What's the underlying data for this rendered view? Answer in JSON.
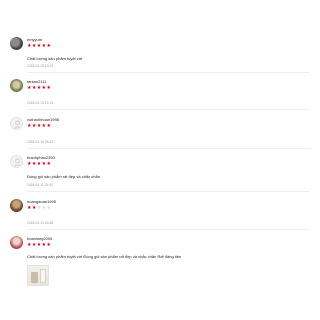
{
  "reviews": [
    {
      "username": "emyyum",
      "rating": 5,
      "comment": "Chất lượng sản phẩm tuyệt vời",
      "date": "2018-04-18 13:23"
    },
    {
      "username": "tantan2111",
      "rating": 5,
      "comment": "",
      "date": "2018-04-13 12:14"
    },
    {
      "username": "vuthanhhuan1998",
      "rating": 5,
      "comment": "",
      "date": "2018-04-15 08:33"
    },
    {
      "username": "thanhphan2390",
      "rating": 5,
      "comment": "Đóng gói sản phẩm rất đẹp và chắc chắn",
      "date": "2018-04-11 15:43"
    },
    {
      "username": "hoangdoan1995",
      "rating": 2,
      "comment": "",
      "date": "2018-04-10 16:38"
    },
    {
      "username": "hoanlong2005",
      "rating": 5,
      "comment": "Chất lượng sản phẩm tuyệt vời Đóng gói sản phẩm rất đẹp và chắc chắn Rất đáng tiền",
      "date": ""
    }
  ],
  "colors": {
    "star": "#d0011b",
    "star_empty": "#d8d8d8",
    "date": "#9a9a9a"
  },
  "icons": {
    "avatar_placeholder": "user-silhouette-icon",
    "star": "star-icon"
  }
}
